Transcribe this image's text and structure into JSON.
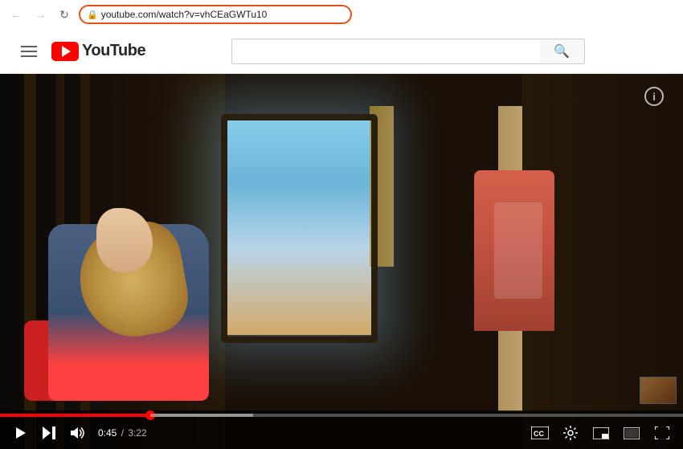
{
  "browser": {
    "back_btn": "←",
    "forward_btn": "→",
    "refresh_btn": "↻",
    "url": "youtube.com/watch?v=vhCEaGWTu10",
    "search_placeholder": ""
  },
  "header": {
    "menu_label": "☰",
    "logo_text": "YouTube",
    "search_placeholder": "",
    "search_btn_label": "🔍"
  },
  "video": {
    "info_btn": "i",
    "time_current": "0:45",
    "time_total": "3:22",
    "progress_pct": 22
  },
  "controls": {
    "play_label": "Play",
    "skip_label": "Skip",
    "volume_label": "Volume",
    "cc_label": "CC",
    "settings_label": "Settings",
    "miniplayer_label": "Miniplayer",
    "theater_label": "Theater",
    "fullscreen_label": "Fullscreen"
  }
}
